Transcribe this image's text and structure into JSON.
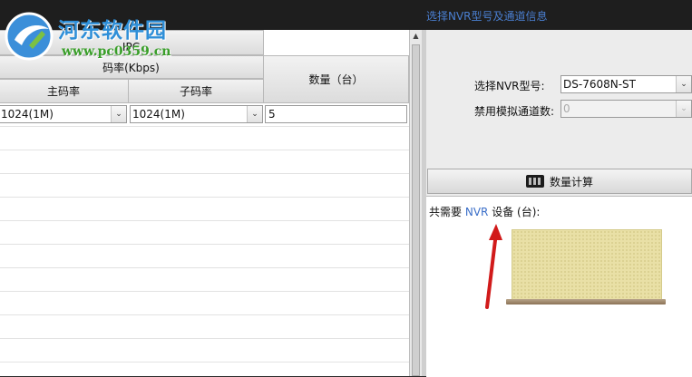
{
  "watermark": {
    "title": "河东软件园",
    "url": "www.pc0359.cn"
  },
  "right_header": {
    "title": "选择NVR型号及通道信息"
  },
  "table": {
    "ipc_label": "IPC",
    "bitrate_label": "码率(Kbps)",
    "main_label": "主码率",
    "sub_label": "子码率",
    "qty_label": "数量（台）",
    "row": {
      "main_value": "1024(1M)",
      "sub_value": "1024(1M)",
      "qty_value": "5"
    }
  },
  "nvr": {
    "model_label": "选择NVR型号:",
    "model_value": "DS-7608N-ST",
    "disable_label": "禁用模拟通道数:",
    "disable_value": "0"
  },
  "calc_button": {
    "label": "数量计算"
  },
  "result": {
    "prefix": "共需要",
    "nvr": "NVR",
    "suffix": "设备 (台):"
  },
  "colors": {
    "accent_blue": "#4a7fd1",
    "arrow_red": "#d11a1a",
    "device_yellow": "#e9e0a6"
  },
  "icons": [
    "calculator-icon",
    "chevron-down-icon",
    "scroll-up-icon"
  ]
}
